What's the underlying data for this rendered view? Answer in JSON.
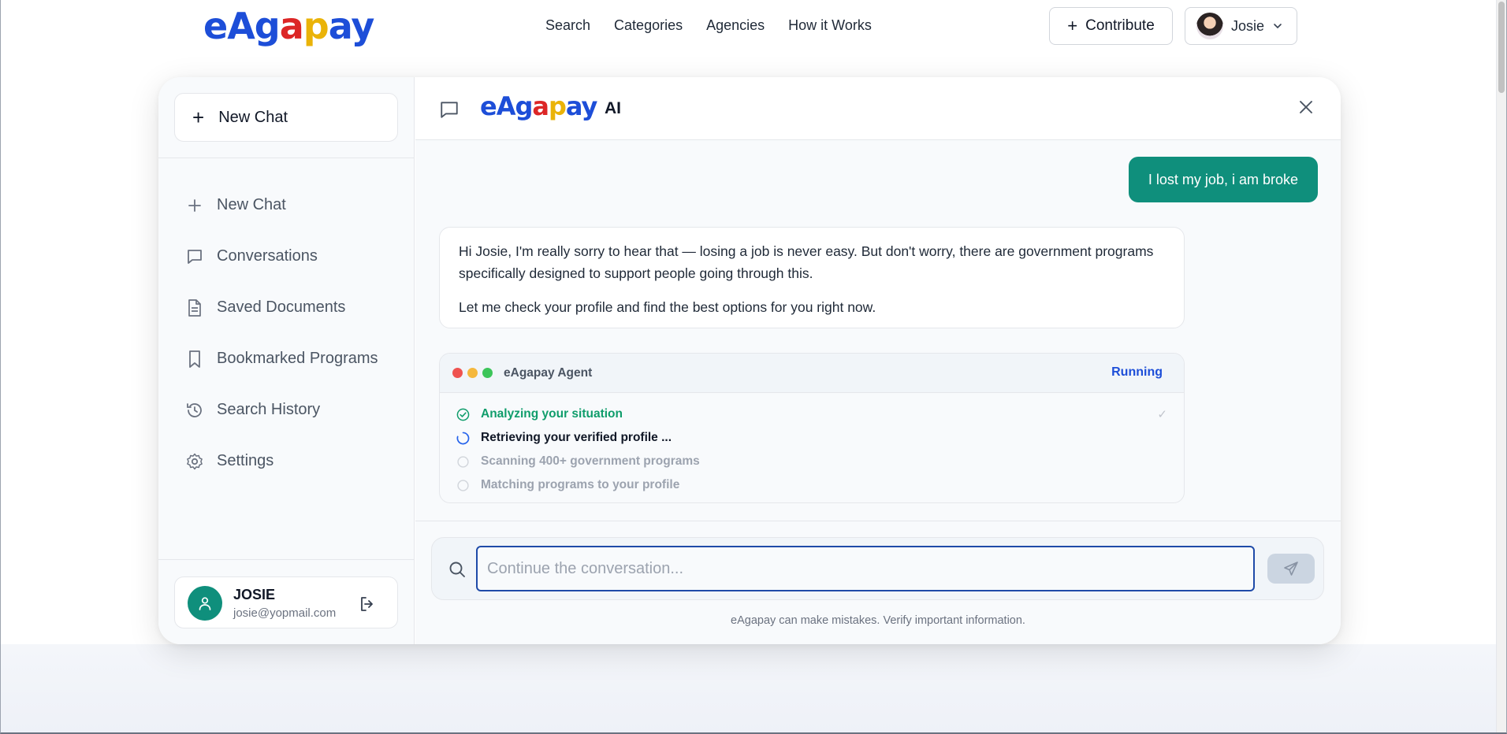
{
  "brand": {
    "logo_parts": [
      {
        "text": "eAg",
        "color": "#1d4ed8"
      },
      {
        "text": "a",
        "color": "#dc2626"
      },
      {
        "text": "p",
        "color": "#eab308"
      },
      {
        "text": "ay",
        "color": "#1d4ed8"
      }
    ]
  },
  "topnav": {
    "links": [
      "Search",
      "Categories",
      "Agencies",
      "How it Works"
    ],
    "contribute_label": "Contribute",
    "user_name": "Josie"
  },
  "sidebar": {
    "new_chat_label": "New Chat",
    "items": [
      {
        "label": "New Chat",
        "icon": "plus-icon"
      },
      {
        "label": "Conversations",
        "icon": "chat-bubble-icon"
      },
      {
        "label": "Saved Documents",
        "icon": "document-icon"
      },
      {
        "label": "Bookmarked Programs",
        "icon": "bookmark-icon"
      },
      {
        "label": "Search History",
        "icon": "history-icon"
      },
      {
        "label": "Settings",
        "icon": "gear-icon"
      }
    ],
    "user": {
      "name": "JOSIE",
      "email": "josie@yopmail.com"
    }
  },
  "chat": {
    "header_suffix": "AI",
    "messages": {
      "user": "I lost my job, i am broke",
      "assistant_p1": "Hi Josie, I'm really sorry to hear that — losing a job is never easy. But don't worry, there are government programs specifically designed to support people going through this.",
      "assistant_p2": "Let me check your profile and find the best options for you right now."
    },
    "agent": {
      "title": "eAgapay Agent",
      "status": "Running",
      "steps": [
        {
          "label": "Analyzing your situation",
          "state": "done"
        },
        {
          "label": "Retrieving your verified profile ...",
          "state": "active"
        },
        {
          "label": "Scanning 400+ government programs",
          "state": "pending"
        },
        {
          "label": "Matching programs to your profile",
          "state": "pending"
        }
      ],
      "done_mark": "✓"
    },
    "composer": {
      "placeholder": "Continue the conversation...",
      "value": ""
    },
    "disclaimer": "eAgapay can make mistakes. Verify important information."
  },
  "colors": {
    "accent_teal": "#0f8f7c",
    "brand_blue": "#1d4ed8",
    "running_blue": "#1d4ed8",
    "done_green": "#0f9d6b"
  }
}
